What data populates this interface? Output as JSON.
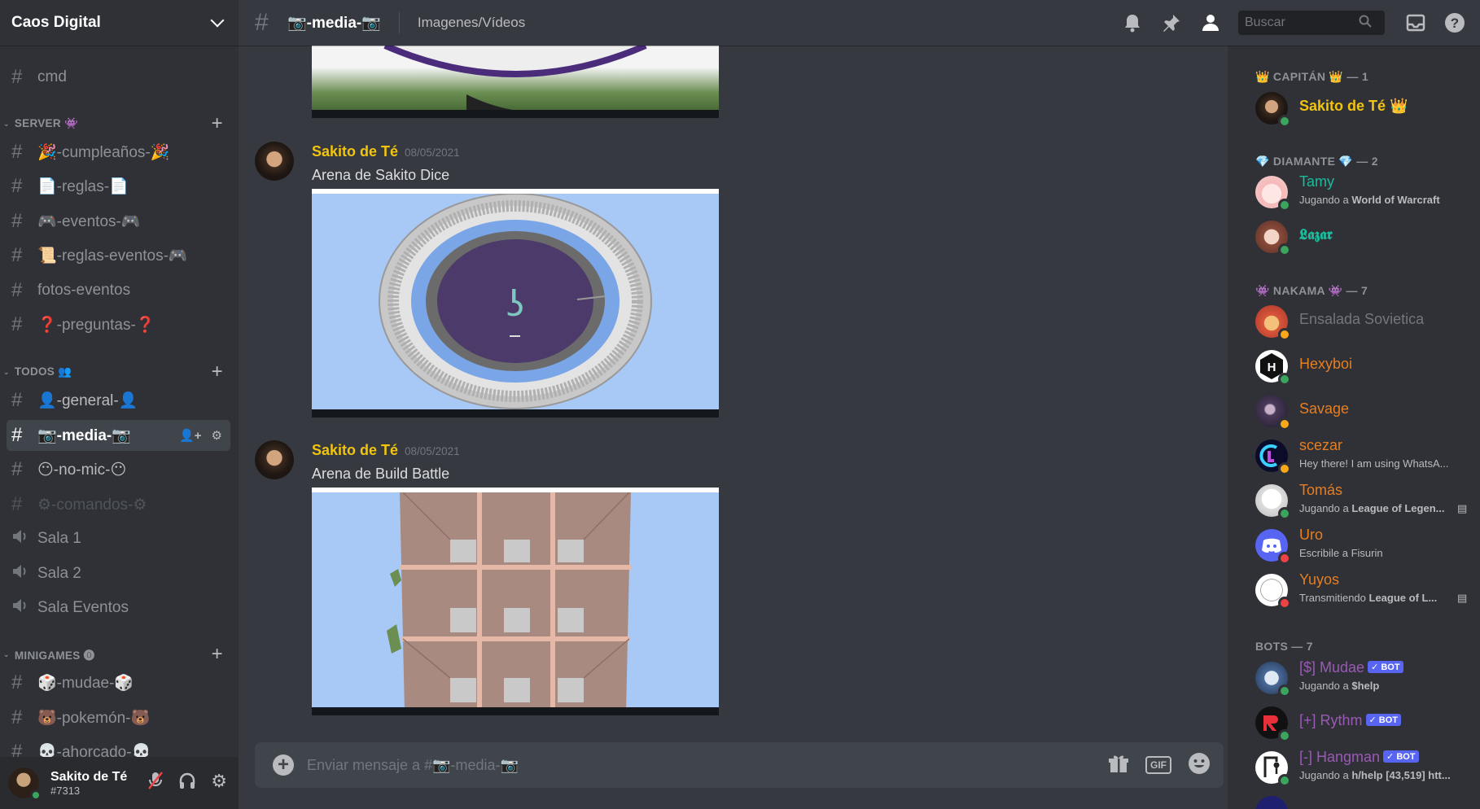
{
  "colors": {
    "accent": "#5865f2",
    "captain": "#f1c40f",
    "orange": "#e67e22",
    "teal": "#1abc9c",
    "purple": "#9b59b6",
    "online": "#3ba55d",
    "idle": "#faa81a",
    "dnd": "#ed4245"
  },
  "guild": {
    "name": "Caos Digital"
  },
  "channels": {
    "top": {
      "label": "cmd"
    },
    "server_cat": "SERVER 👾",
    "server": [
      "🎉-cumpleaños-🎉",
      "📄-reglas-📄",
      "🎮-eventos-🎮",
      "📜-reglas-eventos-🎮",
      "fotos-eventos",
      "❓-preguntas-❓"
    ],
    "todos_cat": "TODOS 👥",
    "todos": [
      "👤-general-👤",
      "📷-media-📷",
      "😶-no-mic-😶",
      "⚙-comandos-⚙"
    ],
    "voice": [
      "Sala 1",
      "Sala 2",
      "Sala Eventos"
    ],
    "minigames_cat": "MINIGAMES ⓿",
    "minigames": [
      "🎲-mudae-🎲",
      "🐻-pokemón-🐻",
      "💀-ahorcado-💀"
    ]
  },
  "user": {
    "name": "Sakito de Té",
    "tag": "#7313"
  },
  "topbar": {
    "channel": "📷-media-📷",
    "topic": "Imagenes/Vídeos",
    "search_placeholder": "Buscar"
  },
  "messages": [
    {
      "author": "Sakito de Té",
      "timestamp": "08/05/2021",
      "text": "Arena de Sakito Dice"
    },
    {
      "author": "Sakito de Té",
      "timestamp": "08/05/2021",
      "text": "Arena de Build Battle"
    }
  ],
  "composer": {
    "placeholder": "Enviar mensaje a #📷-media-📷",
    "gif_label": "GIF"
  },
  "members": {
    "cat1": "👑 CAPITÁN 👑 — 1",
    "captain": {
      "name": "Sakito de Té 👑"
    },
    "cat2": "💎 DIAMANTE 💎 — 2",
    "diamante": [
      {
        "name": "Tamy",
        "activity_prefix": "Jugando a ",
        "activity": "World of Warcraft"
      },
      {
        "name": "𝕷𝖆𝖟𝖆𝖗"
      }
    ],
    "cat3": "👾 NAKAMA 👾 — 7",
    "nakama": [
      {
        "name": "Ensalada Sovietica"
      },
      {
        "name": "Hexyboi"
      },
      {
        "name": "Savage"
      },
      {
        "name": "scezar",
        "activity": "Hey there! I am using WhatsA..."
      },
      {
        "name": "Tomás",
        "activity_prefix": "Jugando a ",
        "activity": "League of Legen..."
      },
      {
        "name": "Uro",
        "activity": "Escribile a Fisurin"
      },
      {
        "name": "Yuyos",
        "activity_prefix": "Transmitiendo ",
        "activity": "League of L..."
      }
    ],
    "cat4": "BOTS — 7",
    "bots": [
      {
        "name": "[$] Mudae",
        "badge": "✓ BOT",
        "activity_prefix": "Jugando a ",
        "activity": "$help"
      },
      {
        "name": "[+] Rythm",
        "badge": "✓ BOT"
      },
      {
        "name": "[-] Hangman",
        "badge": "✓ BOT",
        "activity_prefix": "Jugando a ",
        "activity": "h/help [43,519] htt..."
      }
    ]
  }
}
